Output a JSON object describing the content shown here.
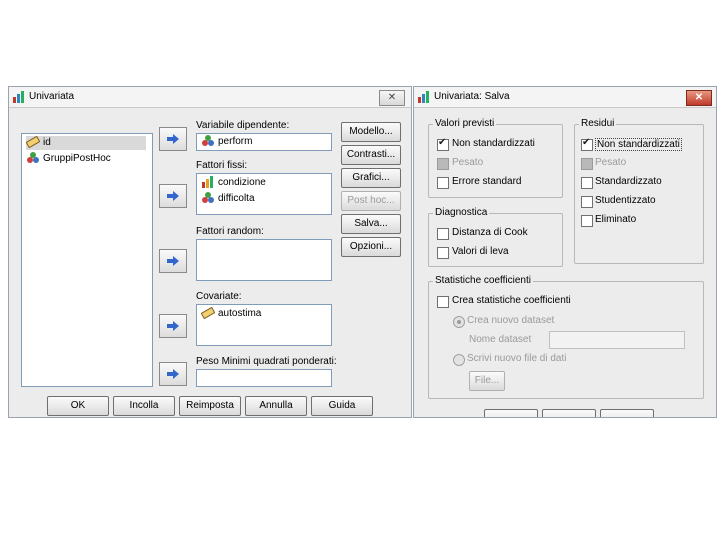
{
  "left_dialog": {
    "title": "Univariata",
    "close_label": "✕",
    "source_vars": [
      {
        "label": "id",
        "icon": "ruler-icon"
      },
      {
        "label": "GruppiPostHoc",
        "icon": "nominal-icon"
      }
    ],
    "dependent": {
      "label": "Variabile dipendente:",
      "value": "perform"
    },
    "fixed": {
      "label": "Fattori fissi:",
      "items": [
        "condizione",
        "difficolta"
      ]
    },
    "random": {
      "label": "Fattori random:"
    },
    "covariates": {
      "label": "Covariate:",
      "items": [
        "autostima"
      ]
    },
    "wls": {
      "label": "Peso Minimi quadrati ponderati:"
    },
    "side_buttons": [
      "Modello...",
      "Contrasti...",
      "Grafici...",
      "Post hoc...",
      "Salva...",
      "Opzioni..."
    ],
    "bottom_buttons": [
      "OK",
      "Incolla",
      "Reimposta",
      "Annulla",
      "Guida"
    ]
  },
  "right_dialog": {
    "title": "Univariata: Salva",
    "close_label": "✕",
    "predicted": {
      "label": "Valori previsti",
      "options": [
        {
          "label": "Non standardizzati",
          "checked": true,
          "disabled": false
        },
        {
          "label": "Pesato",
          "checked": false,
          "disabled": true
        },
        {
          "label": "Errore standard",
          "checked": false,
          "disabled": false
        }
      ]
    },
    "residuals": {
      "label": "Residui",
      "options": [
        {
          "label": "Non standardizzati",
          "checked": true,
          "disabled": false
        },
        {
          "label": "Pesato",
          "checked": false,
          "disabled": true
        },
        {
          "label": "Standardizzato",
          "checked": false,
          "disabled": false
        },
        {
          "label": "Studentizzato",
          "checked": false,
          "disabled": false
        },
        {
          "label": "Eliminato",
          "checked": false,
          "disabled": false
        }
      ]
    },
    "diagnostics": {
      "label": "Diagnostica",
      "options": [
        {
          "label": "Distanza di Cook",
          "checked": false
        },
        {
          "label": "Valori di leva",
          "checked": false
        }
      ]
    },
    "coef": {
      "label": "Statistiche coefficienti",
      "create_label": "Crea statistiche coefficienti",
      "new_dataset": "Crea nuovo dataset",
      "dataset_name": "Nome dataset",
      "write_file": "Scrivi nuovo file di dati",
      "file_button": "File..."
    }
  }
}
